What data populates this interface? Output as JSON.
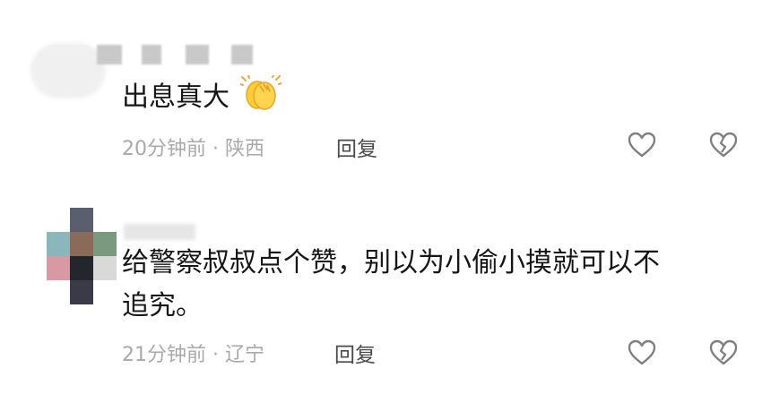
{
  "comments": [
    {
      "text": "出息真大",
      "emoji": "clapping-hands-icon",
      "time": "20分钟前",
      "location": "陕西",
      "reply_label": "回复"
    },
    {
      "text_line1": "给警察叔叔点个赞，别以为小偷小摸就可以不",
      "text_line2": "追究。",
      "time": "21分钟前",
      "location": "辽宁",
      "reply_label": "回复"
    }
  ],
  "meta_separator": "·",
  "colors": {
    "text": "#161616",
    "meta": "#a9a9a9",
    "reply": "#4a4a4a",
    "icon": "#808080",
    "emoji": "#ffcc3a"
  }
}
